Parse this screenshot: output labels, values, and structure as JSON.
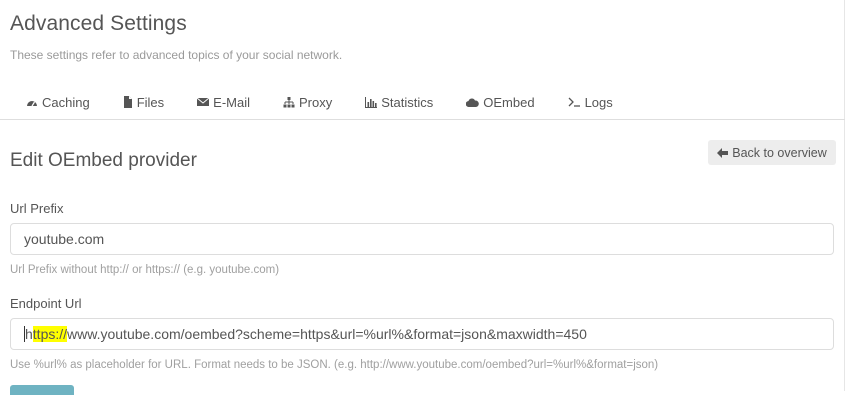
{
  "header": {
    "title": "Advanced Settings",
    "subtitle": "These settings refer to advanced topics of your social network."
  },
  "tabs": [
    {
      "label": "Caching",
      "icon": "dashboard-icon"
    },
    {
      "label": "Files",
      "icon": "file-icon"
    },
    {
      "label": "E-Mail",
      "icon": "envelope-icon"
    },
    {
      "label": "Proxy",
      "icon": "sitemap-icon"
    },
    {
      "label": "Statistics",
      "icon": "bar-chart-icon"
    },
    {
      "label": "OEmbed",
      "icon": "cloud-icon"
    },
    {
      "label": "Logs",
      "icon": "terminal-icon"
    }
  ],
  "section": {
    "title": "Edit OEmbed provider",
    "back_label": "Back to overview"
  },
  "form": {
    "prefix": {
      "label": "Url Prefix",
      "value": "youtube.com",
      "hint": "Url Prefix without http:// or https:// (e.g. youtube.com)"
    },
    "endpoint": {
      "label": "Endpoint Url",
      "value_highlight_start": "h",
      "value_highlight": "ttps://",
      "value_rest": "www.youtube.com/oembed?scheme=https&url=%url%&format=json&maxwidth=450",
      "hint": "Use %url% as placeholder for URL. Format needs to be JSON. (e.g. http://www.youtube.com/oembed?url=%url%&format=json)"
    }
  },
  "colors": {
    "text": "#555555",
    "muted": "#a0a0a0",
    "highlight": "#ffff00",
    "button_bg": "#ededed",
    "save_button": "#6fb3c2"
  }
}
